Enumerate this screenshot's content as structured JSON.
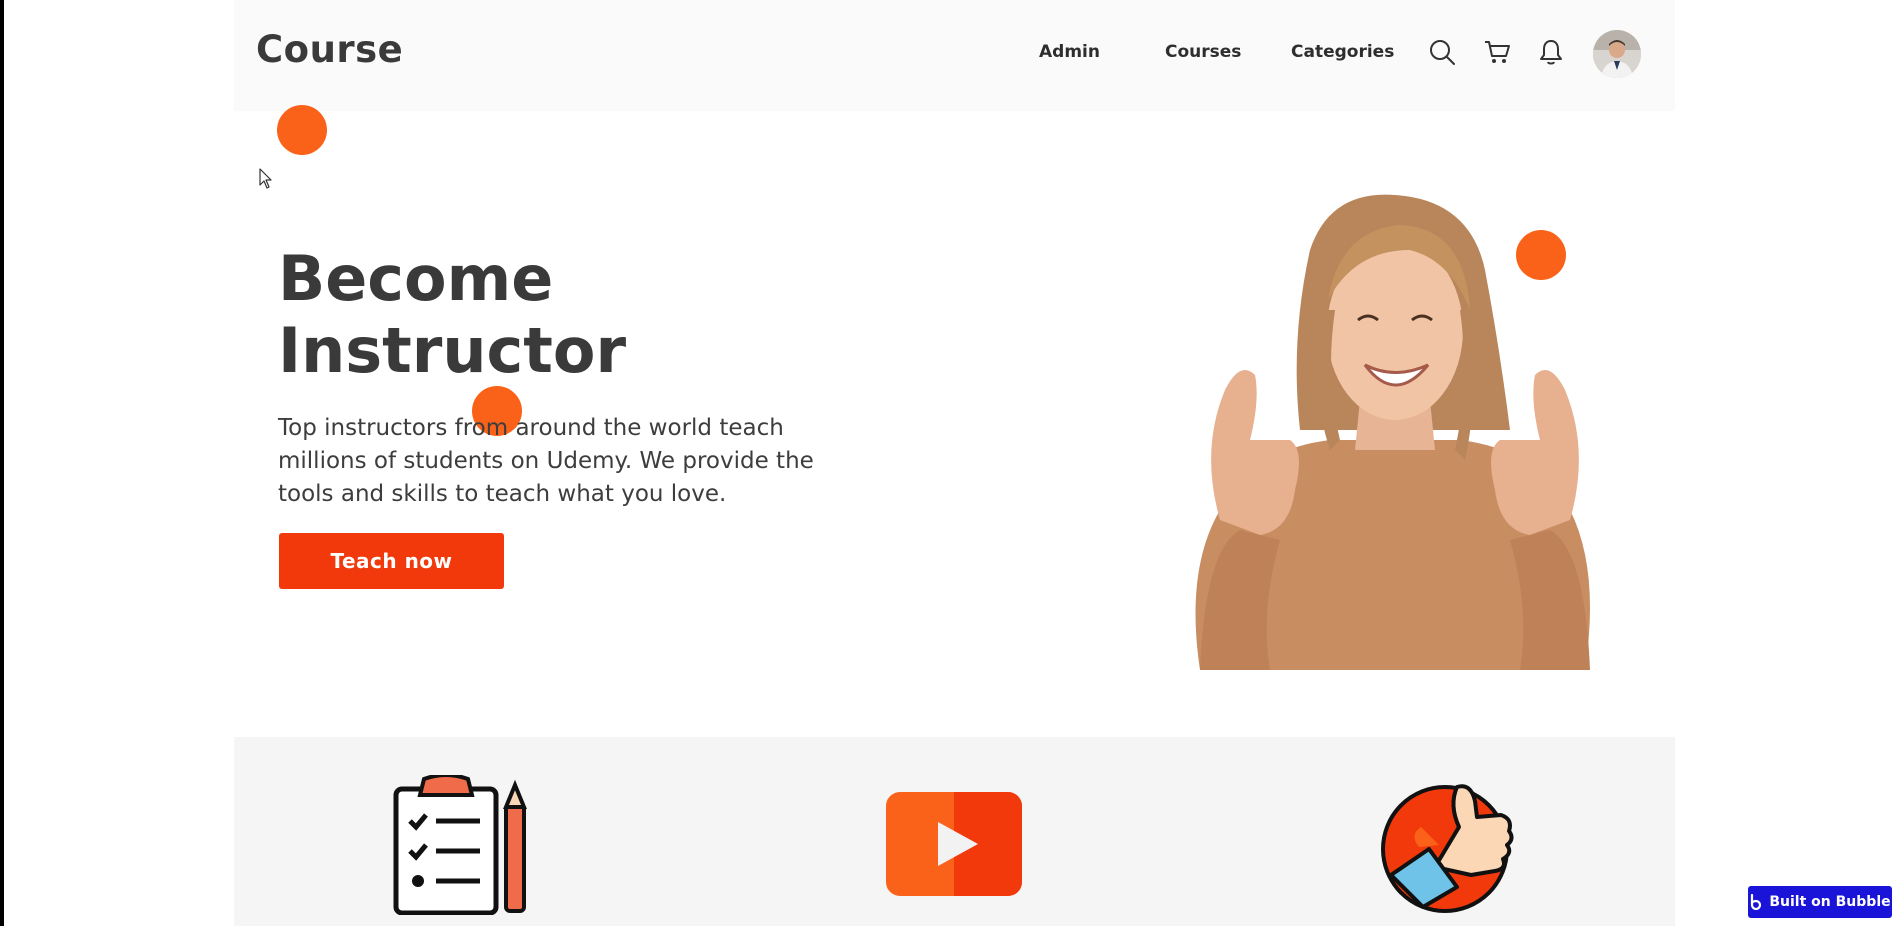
{
  "header": {
    "logo": "Course",
    "nav": [
      {
        "label": "Admin"
      },
      {
        "label": "Courses"
      },
      {
        "label": "Categories"
      }
    ],
    "icons": [
      "search-icon",
      "cart-icon",
      "bell-icon"
    ]
  },
  "hero": {
    "title_line1": "Become",
    "title_line2": "Instructor",
    "description": "Top instructors from around the world teach millions of students on Udemy. We provide the tools and skills to teach what you love.",
    "cta_label": "Teach now"
  },
  "features": {
    "icons": [
      "clipboard-checklist-icon",
      "play-video-icon",
      "thumbs-up-icon"
    ]
  },
  "badge": {
    "label": "Built on Bubble"
  },
  "colors": {
    "accent": "#f2390b",
    "dot": "#fb6219",
    "badge": "#1a14d9"
  }
}
